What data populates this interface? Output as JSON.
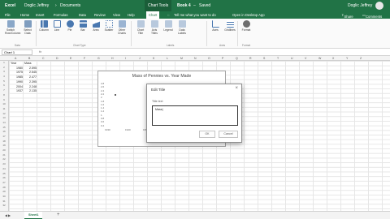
{
  "titlebar": {
    "app": "Excel",
    "path_user": "Doglic Jeffrey",
    "path_sep": "›",
    "path_folder": "Documents",
    "context": "Chart Tools",
    "book": "Book 4",
    "sep": "–",
    "saved": "Saved",
    "user": "Doglic Jeffrey"
  },
  "tabs": [
    "File",
    "Home",
    "Insert",
    "Formulas",
    "Data",
    "Review",
    "View",
    "Help",
    "Chart"
  ],
  "active_tab": "Chart",
  "tell_me": "Tell me what you want to do",
  "open_desktop": "Open in Desktop App",
  "share": "Share",
  "comments": "Comments",
  "ribbon": {
    "buttons": [
      "Switch Row/Column",
      "Select Data",
      "Column",
      "Line",
      "Pie",
      "Bar",
      "Area",
      "Scatter",
      "Other Charts",
      "Chart Title",
      "Axis Titles",
      "Legend",
      "Data Labels",
      "Axes",
      "Gridlines",
      "Format"
    ],
    "groups": [
      "Data",
      "Chart Type",
      "Labels",
      "Axes",
      "Format"
    ]
  },
  "formula_bar": {
    "name_box": "Chart 1",
    "fx": "fx"
  },
  "columns": [
    "A",
    "B",
    "C",
    "D",
    "E",
    "F",
    "G",
    "H",
    "I",
    "J",
    "K",
    "L",
    "M",
    "N",
    "O",
    "P",
    "Q",
    "R",
    "S",
    "T",
    "U",
    "V",
    "W",
    "X",
    "Y",
    "Z"
  ],
  "rows": [
    "1",
    "2",
    "3",
    "4",
    "5",
    "6",
    "7",
    "8",
    "9",
    "10",
    "11",
    "12",
    "13",
    "14",
    "15",
    "16",
    "17",
    "18",
    "19",
    "20",
    "21",
    "22",
    "23",
    "24",
    "25",
    "26",
    "27",
    "28",
    "29",
    "30",
    "31",
    "32"
  ],
  "cells": {
    "header_a": "Year",
    "header_b": "Mass",
    "data": [
      {
        "year": "1980",
        "mass": "2.595"
      },
      {
        "year": "1975",
        "mass": "2.545"
      },
      {
        "year": "1985",
        "mass": "2.477"
      },
      {
        "year": "1990",
        "mass": "2.395"
      },
      {
        "year": "2004",
        "mass": "2.248"
      },
      {
        "year": "1937",
        "mass": "2.135"
      }
    ]
  },
  "chart": {
    "title": "Mass of Pennies vs. Year Made",
    "y_ticks": [
      "2.8",
      "2.6",
      "2.4",
      "2.2",
      "2",
      "1.8",
      "1.6",
      "1.4",
      "1.2",
      "1",
      "0.8",
      "0.6",
      "0.4",
      "0.2",
      "0"
    ],
    "x_ticks": [
      "1930",
      "1940",
      "1950"
    ]
  },
  "chart_data": {
    "type": "scatter",
    "title": "Mass of Pennies vs. Year Made",
    "xlabel": "",
    "ylabel": "",
    "points": [
      {
        "x": 1937,
        "y": 2.1
      },
      {
        "x": 1975,
        "y": 2.5
      }
    ],
    "ylim": [
      0,
      2.8
    ]
  },
  "dialog": {
    "title": "Edit Title",
    "close": "×",
    "label": "Title text",
    "value": "Mass|",
    "ok": "OK",
    "cancel": "Cancel"
  },
  "bottom": {
    "sheet": "Sheet1",
    "add": "+",
    "left_arrows": "◀ ▶"
  }
}
